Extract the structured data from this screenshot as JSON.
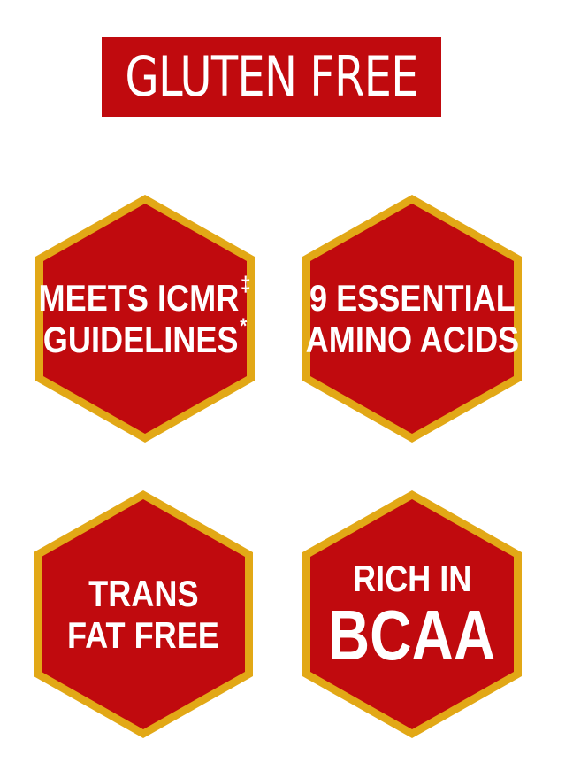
{
  "banner": {
    "text": "GLUTEN FREE"
  },
  "badges": [
    {
      "line1": "MEETS ICMR",
      "line1_mark": "‡",
      "line2": "GUIDELINES",
      "line2_mark": "*"
    },
    {
      "line1": "9 ESSENTIAL",
      "line2": "AMINO ACIDS"
    },
    {
      "line1": "TRANS",
      "line2": "FAT FREE"
    },
    {
      "line1": "RICH IN",
      "line2": "BCAA"
    }
  ],
  "colors": {
    "badge_fill": "#c00a0e",
    "badge_border": "#e2a816",
    "text": "#ffffff",
    "background": "#ffffff"
  }
}
